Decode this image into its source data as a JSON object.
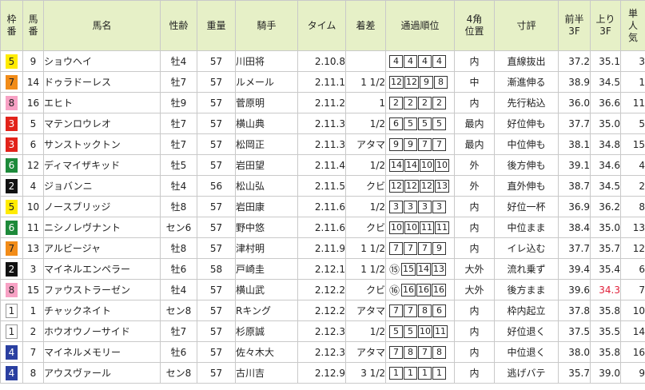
{
  "headers": {
    "waku": "枠\n番",
    "umaban": "馬\n番",
    "name": "馬名",
    "sexage": "性齢",
    "weight": "重量",
    "jockey": "騎手",
    "time": "タイム",
    "margin": "着差",
    "passing": "通過順位",
    "corner4": "4角\n位置",
    "comment": "寸評",
    "first3f": "前半\n3F",
    "last3f": "上り\n3F",
    "pop": "単\n人\n気"
  },
  "rows": [
    {
      "waku": "5",
      "umaban": "9",
      "name": "ショウヘイ",
      "sexage": "牡4",
      "weight": "57",
      "jockey": "川田将",
      "time": "2.10.8",
      "margin": "",
      "passing": [
        "4",
        "4",
        "4",
        "4"
      ],
      "circled": "",
      "corner4": "内",
      "comment": "直線抜出",
      "first3f": "37.2",
      "last3f": "35.1",
      "pop": "3"
    },
    {
      "waku": "7",
      "umaban": "14",
      "name": "ドゥラドーレス",
      "sexage": "牡7",
      "weight": "57",
      "jockey": "ルメール",
      "time": "2.11.1",
      "margin": "1 1/2",
      "passing": [
        "12",
        "12",
        "9",
        "8"
      ],
      "circled": "",
      "corner4": "中",
      "comment": "漸進伸る",
      "first3f": "38.9",
      "last3f": "34.5",
      "pop": "1"
    },
    {
      "waku": "8",
      "umaban": "16",
      "name": "エヒト",
      "sexage": "牡9",
      "weight": "57",
      "jockey": "菅原明",
      "time": "2.11.2",
      "margin": "1",
      "passing": [
        "2",
        "2",
        "2",
        "2"
      ],
      "circled": "",
      "corner4": "内",
      "comment": "先行粘込",
      "first3f": "36.0",
      "last3f": "36.6",
      "pop": "11"
    },
    {
      "waku": "3",
      "umaban": "5",
      "name": "マテンロウレオ",
      "sexage": "牡7",
      "weight": "57",
      "jockey": "横山典",
      "time": "2.11.3",
      "margin": "1/2",
      "passing": [
        "6",
        "5",
        "5",
        "5"
      ],
      "circled": "",
      "corner4": "最内",
      "comment": "好位伸も",
      "first3f": "37.7",
      "last3f": "35.0",
      "pop": "5"
    },
    {
      "waku": "3",
      "umaban": "6",
      "name": "サンストックトン",
      "sexage": "牡7",
      "weight": "57",
      "jockey": "松岡正",
      "time": "2.11.3",
      "margin": "アタマ",
      "passing": [
        "9",
        "9",
        "7",
        "7"
      ],
      "circled": "",
      "corner4": "最内",
      "comment": "中位伸も",
      "first3f": "38.1",
      "last3f": "34.8",
      "pop": "15"
    },
    {
      "waku": "6",
      "umaban": "12",
      "name": "ディマイザキッド",
      "sexage": "牡5",
      "weight": "57",
      "jockey": "岩田望",
      "time": "2.11.4",
      "margin": "1/2",
      "passing": [
        "14",
        "14",
        "10",
        "10"
      ],
      "circled": "",
      "corner4": "外",
      "comment": "後方伸も",
      "first3f": "39.1",
      "last3f": "34.6",
      "pop": "4"
    },
    {
      "waku": "2",
      "umaban": "4",
      "name": "ジョバンニ",
      "sexage": "牡4",
      "weight": "56",
      "jockey": "松山弘",
      "time": "2.11.5",
      "margin": "クビ",
      "passing": [
        "12",
        "12",
        "12",
        "13"
      ],
      "circled": "",
      "corner4": "外",
      "comment": "直外伸も",
      "first3f": "38.7",
      "last3f": "34.5",
      "pop": "2"
    },
    {
      "waku": "5",
      "umaban": "10",
      "name": "ノースブリッジ",
      "sexage": "牡8",
      "weight": "57",
      "jockey": "岩田康",
      "time": "2.11.6",
      "margin": "1/2",
      "passing": [
        "3",
        "3",
        "3",
        "3"
      ],
      "circled": "",
      "corner4": "内",
      "comment": "好位一杯",
      "first3f": "36.9",
      "last3f": "36.2",
      "pop": "8"
    },
    {
      "waku": "6",
      "umaban": "11",
      "name": "ニシノレヴナント",
      "sexage": "セン6",
      "weight": "57",
      "jockey": "野中悠",
      "time": "2.11.6",
      "margin": "クビ",
      "passing": [
        "10",
        "10",
        "11",
        "11"
      ],
      "circled": "",
      "corner4": "内",
      "comment": "中位まま",
      "first3f": "38.4",
      "last3f": "35.0",
      "pop": "13"
    },
    {
      "waku": "7",
      "umaban": "13",
      "name": "アルビージャ",
      "sexage": "牡8",
      "weight": "57",
      "jockey": "津村明",
      "time": "2.11.9",
      "margin": "1 1/2",
      "passing": [
        "7",
        "7",
        "7",
        "9"
      ],
      "circled": "",
      "corner4": "内",
      "comment": "イレ込む",
      "first3f": "37.7",
      "last3f": "35.7",
      "pop": "12"
    },
    {
      "waku": "2",
      "umaban": "3",
      "name": "マイネルエンペラー",
      "sexage": "牡6",
      "weight": "58",
      "jockey": "戸崎圭",
      "time": "2.12.1",
      "margin": "1 1/2",
      "passing": [
        "15",
        "14",
        "13"
      ],
      "circled": "⑮",
      "corner4": "大外",
      "comment": "流れ乗ず",
      "first3f": "39.4",
      "last3f": "35.4",
      "pop": "6"
    },
    {
      "waku": "8",
      "umaban": "15",
      "name": "ファウストラーゼン",
      "sexage": "牡4",
      "weight": "57",
      "jockey": "横山武",
      "time": "2.12.2",
      "margin": "クビ",
      "passing": [
        "16",
        "16",
        "16"
      ],
      "circled": "⑯",
      "corner4": "大外",
      "comment": "後方まま",
      "first3f": "39.6",
      "last3f": "34.3",
      "pop": "7"
    },
    {
      "waku": "1",
      "umaban": "1",
      "name": "チャックネイト",
      "sexage": "セン8",
      "weight": "57",
      "jockey": "Rキング",
      "time": "2.12.2",
      "margin": "アタマ",
      "passing": [
        "7",
        "7",
        "8",
        "6"
      ],
      "circled": "",
      "corner4": "内",
      "comment": "枠内起立",
      "first3f": "37.8",
      "last3f": "35.8",
      "pop": "10"
    },
    {
      "waku": "1",
      "umaban": "2",
      "name": "ホウオウノーサイド",
      "sexage": "牡7",
      "weight": "57",
      "jockey": "杉原誠",
      "time": "2.12.3",
      "margin": "1/2",
      "passing": [
        "5",
        "5",
        "10",
        "11"
      ],
      "circled": "",
      "corner4": "内",
      "comment": "好位退く",
      "first3f": "37.5",
      "last3f": "35.5",
      "pop": "14"
    },
    {
      "waku": "4",
      "umaban": "7",
      "name": "マイネルメモリー",
      "sexage": "牡6",
      "weight": "57",
      "jockey": "佐々木大",
      "time": "2.12.3",
      "margin": "アタマ",
      "passing": [
        "7",
        "8",
        "7",
        "8"
      ],
      "circled": "",
      "corner4": "内",
      "comment": "中位退く",
      "first3f": "38.0",
      "last3f": "35.8",
      "pop": "16"
    },
    {
      "waku": "4",
      "umaban": "8",
      "name": "アウスヴァール",
      "sexage": "セン8",
      "weight": "57",
      "jockey": "古川吉",
      "time": "2.12.9",
      "margin": "3 1/2",
      "passing": [
        "1",
        "1",
        "1",
        "1"
      ],
      "circled": "",
      "corner4": "内",
      "comment": "逃げバテ",
      "first3f": "35.7",
      "last3f": "39.0",
      "pop": "9"
    }
  ],
  "highlight": {
    "row": 11,
    "field": "last3f",
    "color": "#e0203a"
  },
  "separators": [
    5,
    10,
    15
  ],
  "frame_colors": {
    "1": "#ffffff",
    "2": "#111111",
    "3": "#e2231a",
    "4": "#2a3fa1",
    "5": "#ffeb00",
    "6": "#1d8a3a",
    "7": "#f28c18",
    "8": "#f7a1c4"
  }
}
